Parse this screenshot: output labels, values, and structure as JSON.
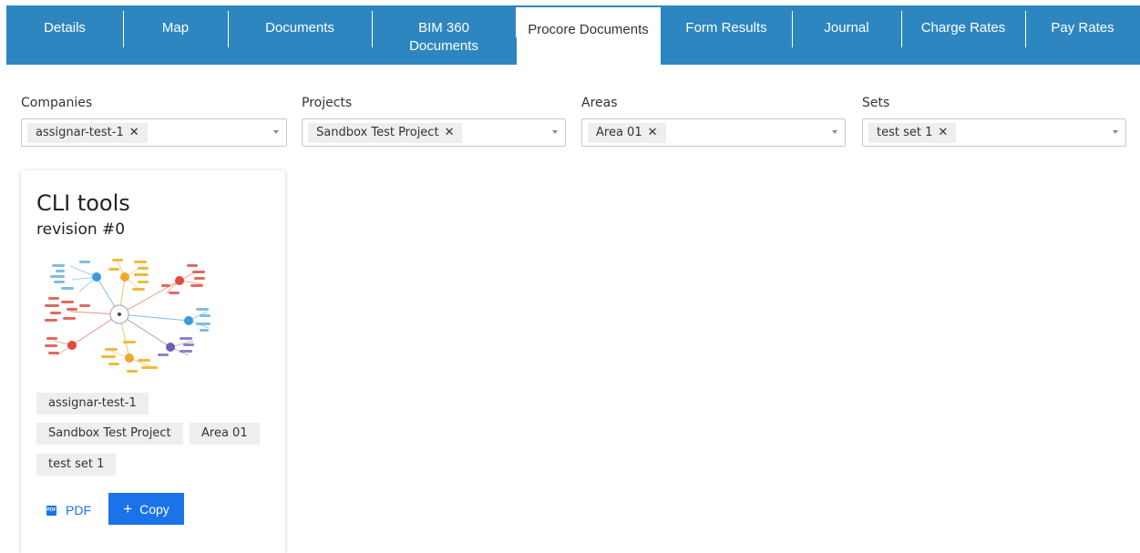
{
  "tabs": [
    {
      "label": "Details"
    },
    {
      "label": "Map"
    },
    {
      "label": "Documents"
    },
    {
      "label": "BIM 360\nDocuments"
    },
    {
      "label": "Procore Documents"
    },
    {
      "label": "Form Results"
    },
    {
      "label": "Journal"
    },
    {
      "label": "Charge Rates"
    },
    {
      "label": "Pay Rates"
    }
  ],
  "active_tab": "Procore Documents",
  "filters": {
    "companies": {
      "label": "Companies",
      "value": "assignar-test-1"
    },
    "projects": {
      "label": "Projects",
      "value": "Sandbox Test Project"
    },
    "areas": {
      "label": "Areas",
      "value": "Area 01"
    },
    "sets": {
      "label": "Sets",
      "value": "test set 1"
    }
  },
  "card": {
    "title": "CLI tools",
    "revision": "revision #0",
    "tags": [
      "assignar-test-1",
      "Sandbox Test Project",
      "Area 01",
      "test set 1"
    ],
    "pdf_label": "PDF",
    "pdf_icon_text": "PDF",
    "copy_label": "Copy",
    "copy_icon": "+"
  },
  "colors": {
    "tabbar": "#2e86c1",
    "button": "#1a73e8"
  }
}
